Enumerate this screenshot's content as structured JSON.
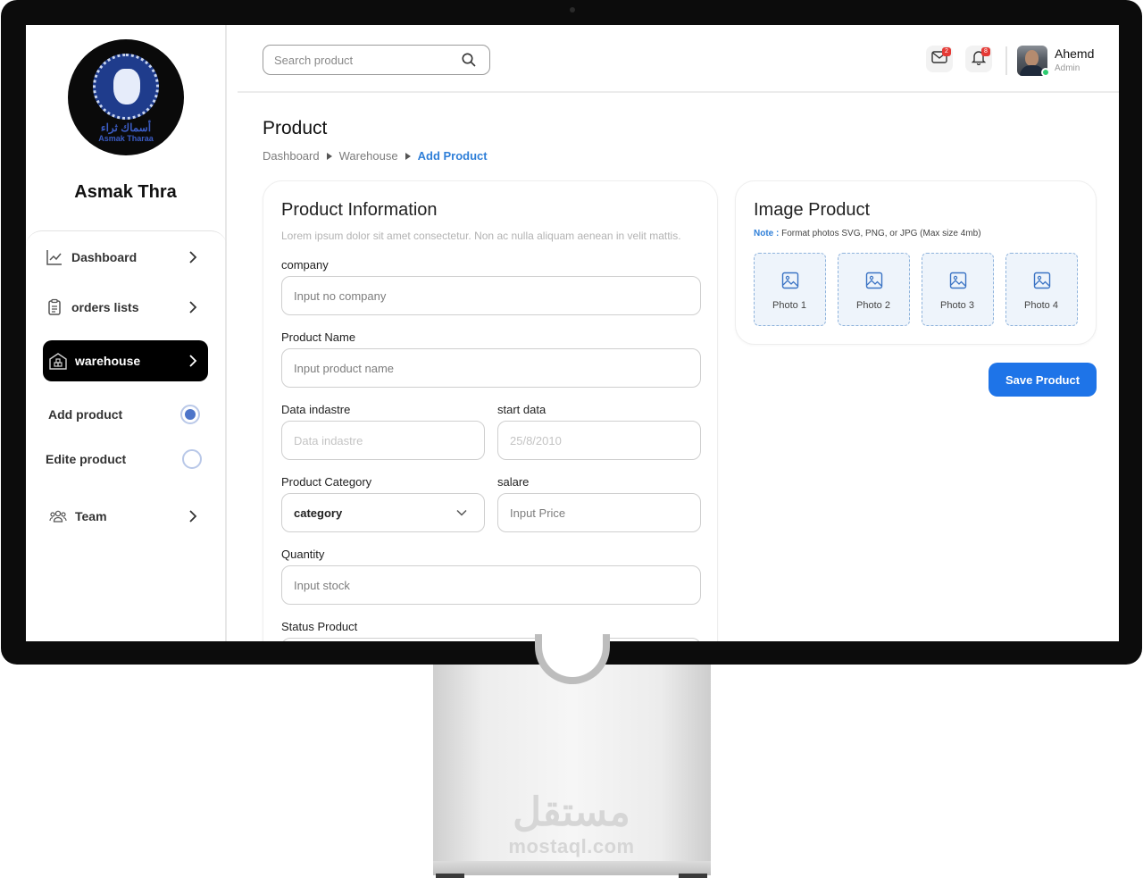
{
  "brand": {
    "name": "Asmak Thra",
    "logo_text_ar": "أسماك ثراء",
    "logo_text_en": "Asmak Tharaa"
  },
  "sidebar": {
    "items": [
      {
        "label": "Dashboard",
        "icon": "chart-line-icon"
      },
      {
        "label": "orders lists",
        "icon": "clipboard-icon"
      },
      {
        "label": "warehouse",
        "icon": "warehouse-icon",
        "active": true
      },
      {
        "label": "Team",
        "icon": "team-icon"
      }
    ],
    "sub_items": [
      {
        "label": "Add product",
        "selected": true
      },
      {
        "label": "Edite product",
        "selected": false
      }
    ]
  },
  "topbar": {
    "search_placeholder": "Search product",
    "mail_badge": "2",
    "notif_badge": "8",
    "user_name": "Ahemd",
    "user_role": "Admin"
  },
  "page": {
    "title": "Product",
    "breadcrumb": [
      "Dashboard",
      "Warehouse",
      "Add Product"
    ]
  },
  "form": {
    "title": "Product Information",
    "description": "Lorem ipsum dolor sit amet consectetur. Non ac nulla aliquam aenean in velit mattis.",
    "fields": {
      "company": {
        "label": "company",
        "placeholder": "Input no company"
      },
      "product_name": {
        "label": "Product Name",
        "placeholder": "Input product name"
      },
      "data_indastre": {
        "label": "Data indastre",
        "placeholder": "Data indastre"
      },
      "start_data": {
        "label": "start data",
        "placeholder": "25/8/2010"
      },
      "category": {
        "label": "Product Category",
        "value": "category"
      },
      "salare": {
        "label": "salare",
        "placeholder": "Input Price"
      },
      "quantity": {
        "label": "Quantity",
        "placeholder": "Input stock"
      },
      "status": {
        "label": "Status Product"
      }
    }
  },
  "image_product": {
    "title": "Image Product",
    "note_key": "Note :",
    "note_text": "Format photos SVG, PNG, or JPG (Max size 4mb)",
    "photos": [
      "Photo 1",
      "Photo 2",
      "Photo 3",
      "Photo 4"
    ]
  },
  "actions": {
    "save_label": "Save Product"
  },
  "watermark": {
    "ar": "مستقل",
    "lat": "mostaql.com"
  },
  "colors": {
    "accent": "#1e74e8",
    "active_nav": "#000000",
    "badge": "#e53935",
    "online": "#2ecc71"
  }
}
